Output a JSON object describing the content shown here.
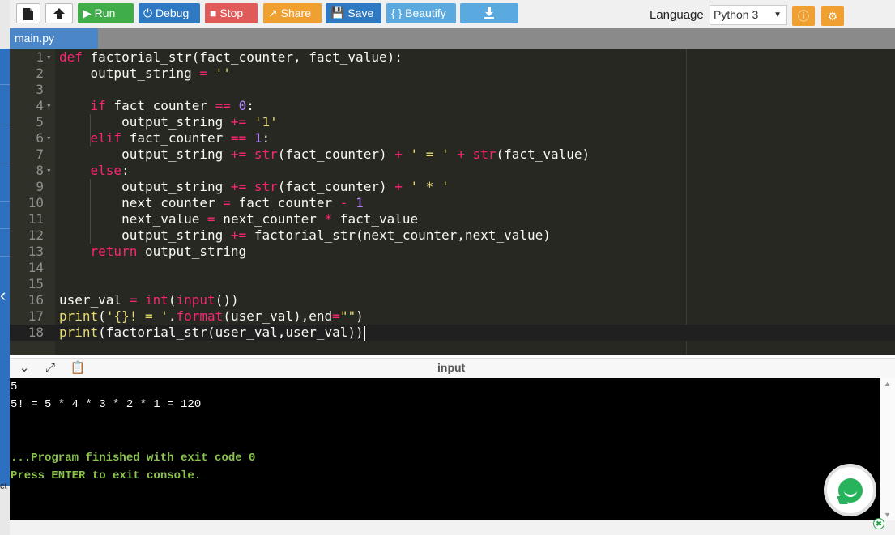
{
  "toolbar": {
    "new_file_icon": "file-icon",
    "upload_icon": "upload-icon",
    "run_label": "Run",
    "debug_label": "Debug",
    "stop_label": "Stop",
    "share_label": "Share",
    "save_label": "Save",
    "beautify_label": "{ } Beautify",
    "download_icon": "download-icon",
    "language_label": "Language",
    "language_value": "Python 3",
    "info_icon": "info-icon",
    "settings_icon": "gear-icon"
  },
  "tabs": [
    {
      "label": "main.py"
    }
  ],
  "editor": {
    "cursor_line": 18,
    "lines": [
      "def factorial_str(fact_counter, fact_value):",
      "    output_string = ''",
      "",
      "    if fact_counter == 0:",
      "        output_string += '1'",
      "    elif fact_counter == 1:",
      "        output_string += str(fact_counter) + ' = ' + str(fact_value)",
      "    else:",
      "        output_string += str(fact_counter) + ' * '",
      "        next_counter = fact_counter - 1",
      "        next_value = next_counter * fact_value",
      "        output_string += factorial_str(next_counter,next_value)",
      "    return output_string",
      "",
      "",
      "user_val = int(input())",
      "print('{}! = '.format(user_val),end=\"\")",
      "print(factorial_str(user_val,user_val))"
    ]
  },
  "console_bar": {
    "title": "input",
    "collapse_icon": "chevron-down-icon",
    "expand_icon": "expand-icon",
    "copy_icon": "copy-icon"
  },
  "console": {
    "lines": [
      "5",
      "5! = 5 * 4 * 3 * 2 * 1 = 120",
      "",
      "",
      "...Program finished with exit code 0",
      "Press ENTER to exit console."
    ]
  },
  "side": {
    "partial_text": "ct"
  },
  "colors": {
    "run": "#3fae49",
    "debug": "#2f79c3",
    "stop": "#e05a5a",
    "share": "#f0a030",
    "save": "#2f79c3",
    "beautify": "#5aaae0",
    "download": "#5aaae0",
    "editor_bg": "#272822",
    "console_green": "#8ac34a"
  }
}
